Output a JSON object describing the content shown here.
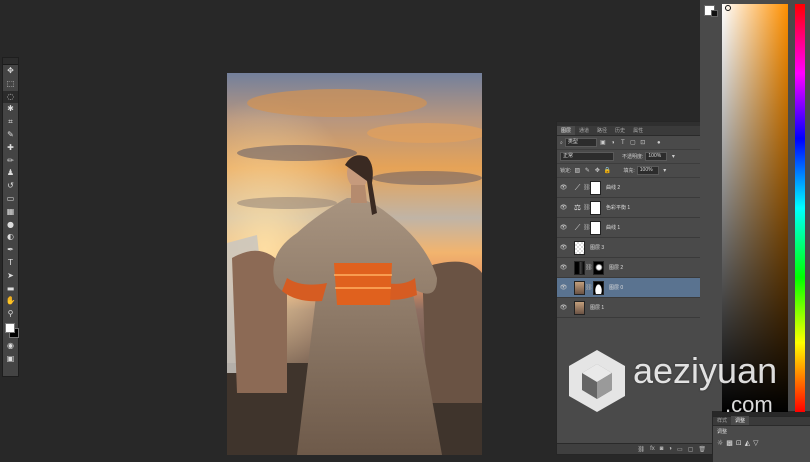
{
  "toolbar": {
    "tools": [
      {
        "name": "move-tool",
        "glyph": "✥"
      },
      {
        "name": "marquee-tool",
        "glyph": "⬚"
      },
      {
        "name": "lasso-tool",
        "glyph": "◌",
        "selected": true
      },
      {
        "name": "magic-wand-tool",
        "glyph": "✱"
      },
      {
        "name": "crop-tool",
        "glyph": "⌗"
      },
      {
        "name": "eyedropper-tool",
        "glyph": "✎"
      },
      {
        "name": "healing-brush-tool",
        "glyph": "✚"
      },
      {
        "name": "brush-tool",
        "glyph": "✏"
      },
      {
        "name": "clone-stamp-tool",
        "glyph": "♟"
      },
      {
        "name": "history-brush-tool",
        "glyph": "↺"
      },
      {
        "name": "eraser-tool",
        "glyph": "▭"
      },
      {
        "name": "gradient-tool",
        "glyph": "▦"
      },
      {
        "name": "blur-tool",
        "glyph": "●"
      },
      {
        "name": "dodge-tool",
        "glyph": "◐"
      },
      {
        "name": "pen-tool",
        "glyph": "✒"
      },
      {
        "name": "type-tool",
        "glyph": "T"
      },
      {
        "name": "path-selection-tool",
        "glyph": "➤"
      },
      {
        "name": "shape-tool",
        "glyph": "▬"
      },
      {
        "name": "hand-tool",
        "glyph": "✋"
      },
      {
        "name": "zoom-tool",
        "glyph": "⚲"
      }
    ],
    "foreground_color": "#ffffff",
    "background_color": "#000000",
    "bottom_icons": [
      {
        "name": "quick-mask-icon",
        "glyph": "◉"
      },
      {
        "name": "screen-mode-icon",
        "glyph": "▣"
      }
    ]
  },
  "canvas": {
    "description_colors": {
      "sky_top": "#7d86a0",
      "sky_mid": "#e3a457",
      "horizon": "#f2c882",
      "ground": "#4a3c32"
    }
  },
  "layers_panel": {
    "tabs": [
      "图层",
      "通道",
      "路径",
      "历史",
      "属性"
    ],
    "filter_kind": "类型",
    "blend_mode": "正常",
    "opacity_label": "不透明度:",
    "opacity_value": "100%",
    "lock_label": "锁定:",
    "fill_label": "填充:",
    "fill_value": "100%",
    "layers": [
      {
        "name": "曲线 2",
        "type": "adjustment",
        "icon": "curves-icon",
        "glyph": "⟋",
        "mask": "#ffffff"
      },
      {
        "name": "色彩平衡 1",
        "type": "adjustment",
        "icon": "color-balance-icon",
        "glyph": "⚖",
        "mask": "#ffffff"
      },
      {
        "name": "曲线 1",
        "type": "adjustment",
        "icon": "curves-icon",
        "glyph": "⟋",
        "mask": "#ffffff"
      },
      {
        "name": "图层 3",
        "type": "transparent"
      },
      {
        "name": "图层 2",
        "type": "dark-mask"
      },
      {
        "name": "图层 0",
        "type": "photo-mask",
        "selected": true
      },
      {
        "name": "图层 1",
        "type": "photo"
      }
    ],
    "bottom_icons": [
      "link",
      "fx",
      "mask",
      "adjust",
      "group",
      "new",
      "delete"
    ],
    "bottom_glyphs": [
      "⛓",
      "fx",
      "◙",
      "◑",
      "▭",
      "▢",
      "🗑"
    ]
  },
  "color_panel": {
    "hue": "#ff9000"
  },
  "adjustments_panel": {
    "tabs": [
      "样式",
      "调整"
    ],
    "title": "调整",
    "icons": [
      "☼",
      "▩",
      "⊡",
      "◭",
      "▽"
    ]
  },
  "watermark": {
    "text": "aeziyuan",
    ".com_text": ".com",
    "com_text": ".com"
  },
  "accent": {
    "selection": "#5a7390"
  }
}
